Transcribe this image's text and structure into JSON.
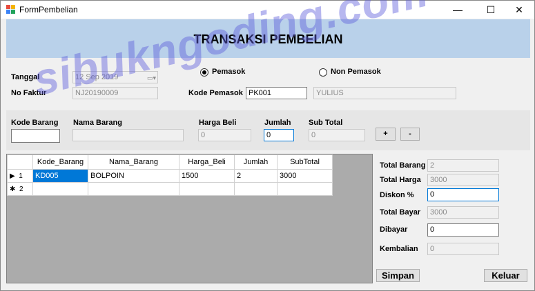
{
  "window": {
    "title": "FormPembelian",
    "minimize": "—",
    "maximize": "☐",
    "close": "✕"
  },
  "header": {
    "title": "TRANSAKSI PEMBELIAN"
  },
  "form": {
    "tanggal_label": "Tanggal",
    "tanggal_value": "12 Sep  2019",
    "nofaktur_label": "No Faktur",
    "nofaktur_value": "NJ20190009",
    "radio_pemasok": "Pemasok",
    "radio_non_pemasok": "Non Pemasok",
    "kode_pemasok_label": "Kode Pemasok",
    "kode_pemasok_value": "PK001",
    "nama_pemasok_value": "YULIUS"
  },
  "item": {
    "kode_label": "Kode Barang",
    "nama_label": "Nama Barang",
    "harga_label": "Harga Beli",
    "harga_value": "0",
    "jumlah_label": "Jumlah",
    "jumlah_value": "0",
    "subtotal_label": "Sub Total",
    "subtotal_value": "0",
    "add_label": "+",
    "remove_label": "-"
  },
  "grid": {
    "columns": [
      "Kode_Barang",
      "Nama_Barang",
      "Harga_Beli",
      "Jumlah",
      "SubTotal"
    ],
    "rows": [
      {
        "marker": "▶",
        "num": "1",
        "kode": "KD005",
        "nama": "BOLPOIN",
        "harga": "1500",
        "jumlah": "2",
        "subtotal": "3000"
      },
      {
        "marker": "✱",
        "num": "2",
        "kode": "",
        "nama": "",
        "harga": "",
        "jumlah": "",
        "subtotal": ""
      }
    ]
  },
  "summary": {
    "total_barang_label": "Total Barang",
    "total_barang_value": "2",
    "total_harga_label": "Total Harga",
    "total_harga_value": "3000",
    "diskon_label": "Diskon %",
    "diskon_value": "0",
    "total_bayar_label": "Total Bayar",
    "total_bayar_value": "3000",
    "dibayar_label": "Dibayar",
    "dibayar_value": "0",
    "kembalian_label": "Kembalian",
    "kembalian_value": "0"
  },
  "actions": {
    "simpan": "Simpan",
    "keluar": "Keluar"
  },
  "watermark": "sibukngoding.com"
}
